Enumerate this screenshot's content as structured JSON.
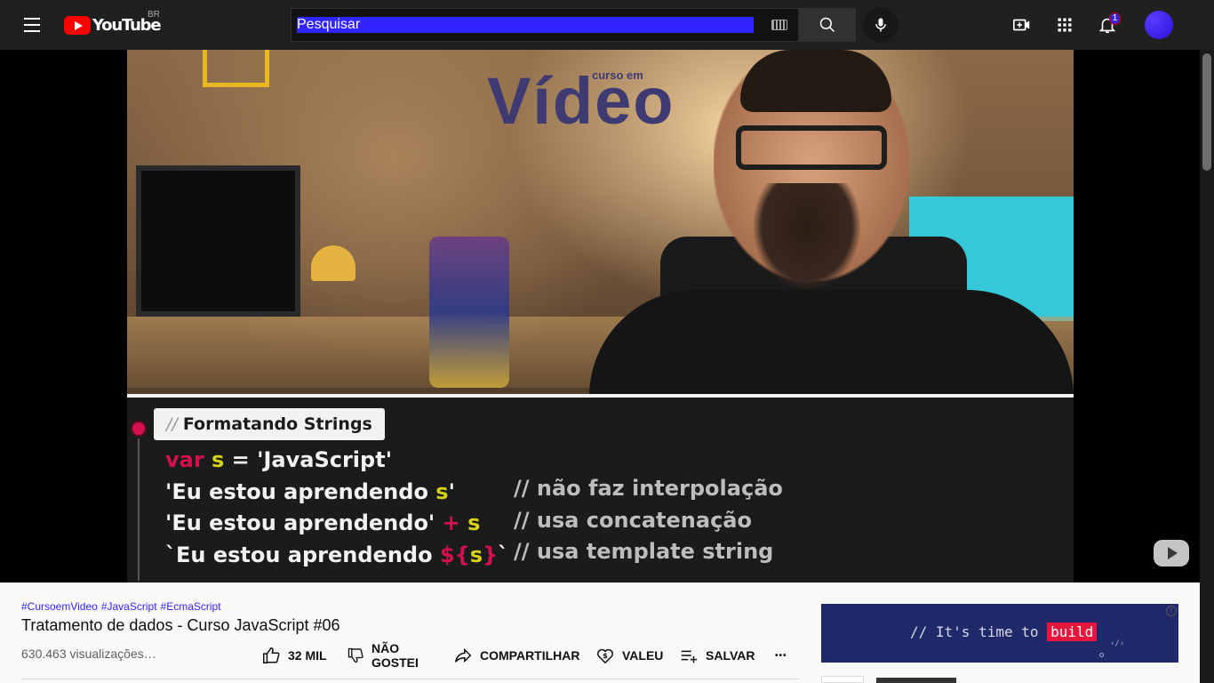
{
  "header": {
    "logo_text": "YouTube",
    "country_code": "BR",
    "search_placeholder": "Pesquisar",
    "notification_count": "1"
  },
  "video_overlay": {
    "sign_text": "Vídeo",
    "sign_small": "curso em",
    "code_title_comment": "//",
    "code_title": "Formatando Strings",
    "line1": {
      "kw": "var",
      "var": " s",
      "rest": " = 'JavaScript'"
    },
    "line2": {
      "str": "'Eu estou aprendendo ",
      "var": "s",
      "end": "'"
    },
    "line3": {
      "str": "'Eu estou aprendendo'",
      "op": " + ",
      "var": "s"
    },
    "line4": {
      "str": "`Eu estou aprendendo ",
      "op": "${",
      "var": "s",
      "op2": "}",
      "end": "`"
    },
    "comments": [
      "// não faz interpolação",
      "// usa concatenação",
      "// usa template string"
    ]
  },
  "video_info": {
    "hashtags": [
      "#CursoemVideo",
      "#JavaScript",
      "#EcmaScript"
    ],
    "title": "Tratamento de dados - Curso JavaScript #06",
    "views": "630.463 visualizações…",
    "actions": {
      "like": "32 MIL",
      "dislike_line1": "NÃO",
      "dislike_line2": "GOSTEI",
      "share": "COMPARTILHAR",
      "thanks": "VALEU",
      "save": "SALVAR",
      "more": "•••"
    }
  },
  "ad": {
    "text_before": "// It's time to ",
    "highlight": "build",
    "code_glyph": "‹/›",
    "info_glyph": "i"
  },
  "colors": {
    "brand_red": "#ff0000",
    "accent_blue": "#3224ff",
    "code_pink": "#d4114d",
    "code_yellow": "#d6d219"
  }
}
